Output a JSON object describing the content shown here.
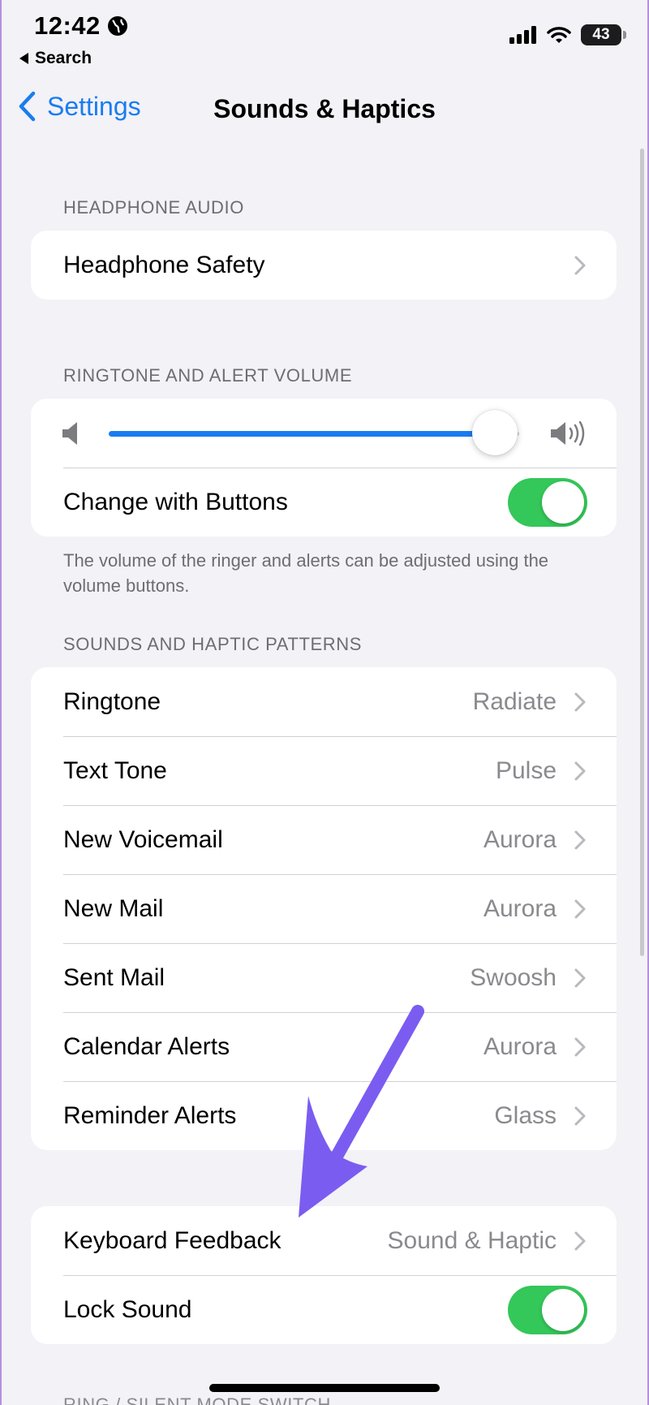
{
  "status_bar": {
    "time": "12:42",
    "back_app": "Search",
    "battery": "43"
  },
  "nav": {
    "back_label": "Settings",
    "title": "Sounds & Haptics"
  },
  "headphone_audio": {
    "header": "HEADPHONE AUDIO",
    "items": [
      {
        "label": "Headphone Safety"
      }
    ]
  },
  "ringtone_volume": {
    "header": "RINGTONE AND ALERT VOLUME",
    "volume_level": 0.94,
    "change_with_buttons": {
      "label": "Change with Buttons",
      "on": true
    },
    "footer": "The volume of the ringer and alerts can be adjusted using the volume buttons."
  },
  "sound_patterns": {
    "header": "SOUNDS AND HAPTIC PATTERNS",
    "items": [
      {
        "label": "Ringtone",
        "value": "Radiate"
      },
      {
        "label": "Text Tone",
        "value": "Pulse"
      },
      {
        "label": "New Voicemail",
        "value": "Aurora"
      },
      {
        "label": "New Mail",
        "value": "Aurora"
      },
      {
        "label": "Sent Mail",
        "value": "Swoosh"
      },
      {
        "label": "Calendar Alerts",
        "value": "Aurora"
      },
      {
        "label": "Reminder Alerts",
        "value": "Glass"
      }
    ]
  },
  "feedback": {
    "keyboard_feedback": {
      "label": "Keyboard Feedback",
      "value": "Sound & Haptic"
    },
    "lock_sound": {
      "label": "Lock Sound",
      "on": true
    }
  },
  "next_section_header": "RING / SILENT MODE SWITCH",
  "colors": {
    "accent": "#1a7cf0",
    "toggle_on": "#34c759",
    "annotation_arrow": "#7b5cf0",
    "background": "#f2f2f7"
  },
  "icons": [
    "globe-icon",
    "cellular-signal-icon",
    "wifi-icon",
    "battery-icon",
    "chevron-left-icon",
    "chevron-right-icon",
    "speaker-low-icon",
    "speaker-high-icon",
    "annotation-arrow"
  ]
}
